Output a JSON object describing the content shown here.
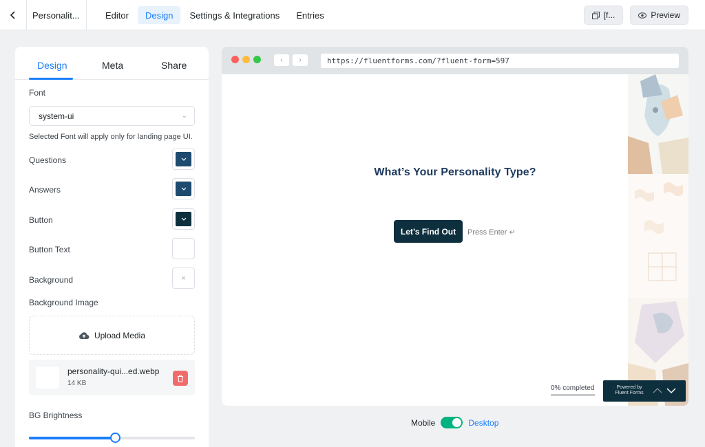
{
  "header": {
    "back_icon": "chevron-left-icon",
    "form_name": "Personalit...",
    "tabs": [
      {
        "label": "Editor",
        "active": false
      },
      {
        "label": "Design",
        "active": true
      },
      {
        "label": "Settings & Integrations",
        "active": false
      },
      {
        "label": "Entries",
        "active": false
      }
    ],
    "shortcode_label": "[f...",
    "preview_label": "Preview"
  },
  "panel": {
    "tabs": [
      "Design",
      "Meta",
      "Share"
    ],
    "font_label": "Font",
    "font_value": "system-ui",
    "font_hint": "Selected Font will apply only for landing page UI.",
    "colors": [
      {
        "label": "Questions",
        "color": "#1d4a6e"
      },
      {
        "label": "Answers",
        "color": "#1d4a6e"
      },
      {
        "label": "Button",
        "color": "#0e2f3e"
      },
      {
        "label": "Button Text",
        "color": "#ffffff"
      },
      {
        "label": "Background",
        "color": ""
      }
    ],
    "bg_image_label": "Background Image",
    "upload_label": "Upload Media",
    "file_name": "personality-qui...ed.webp",
    "file_size": "14 KB",
    "brightness_label": "BG Brightness",
    "brightness_value": 0.52
  },
  "browser": {
    "url": "https://fluentforms.com/?fluent-form=597",
    "question": "What’s Your Personality Type?",
    "button_label": "Let’s Find Out",
    "press_enter": "Press Enter ↵",
    "progress_text": "0% completed",
    "powered_line1": "Powered by",
    "powered_line2": "Fluent Forms"
  },
  "mode": {
    "mobile_label": "Mobile",
    "desktop_label": "Desktop"
  },
  "colors": {
    "accent": "#1a7efb",
    "dark_button": "#0e2f3e",
    "toggle": "#00b27f",
    "delete": "#f26b6b"
  }
}
